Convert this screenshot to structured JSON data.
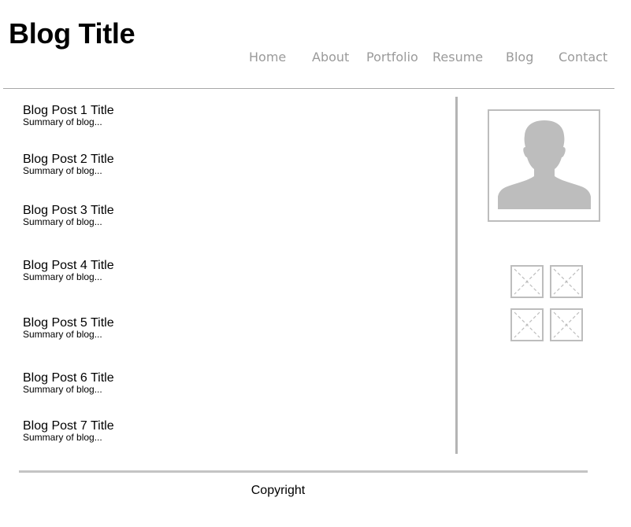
{
  "header": {
    "title": "Blog Title"
  },
  "nav": {
    "items": [
      {
        "label": "Home"
      },
      {
        "label": "About"
      },
      {
        "label": "Portfolio"
      },
      {
        "label": "Resume"
      },
      {
        "label": "Blog"
      },
      {
        "label": "Contact"
      }
    ]
  },
  "posts": [
    {
      "title": "Blog Post 1 Title",
      "summary": "Summary of blog..."
    },
    {
      "title": "Blog Post 2 Title",
      "summary": "Summary of blog..."
    },
    {
      "title": "Blog Post 3 Title",
      "summary": "Summary of blog..."
    },
    {
      "title": "Blog Post 4 Title",
      "summary": "Summary of blog..."
    },
    {
      "title": "Blog Post 5 Title",
      "summary": "Summary of blog..."
    },
    {
      "title": "Blog Post 6 Title",
      "summary": "Summary of blog..."
    },
    {
      "title": "Blog Post 7 Title",
      "summary": "Summary of blog..."
    }
  ],
  "sidebar": {
    "avatar_icon": "person-silhouette-icon",
    "thumbnail_icon": "image-placeholder-icon"
  },
  "footer": {
    "copyright": "Copyright"
  },
  "colors": {
    "nav_text": "#9a9a9a",
    "rule": "#b4b4b4",
    "placeholder": "#bdbdbd"
  }
}
